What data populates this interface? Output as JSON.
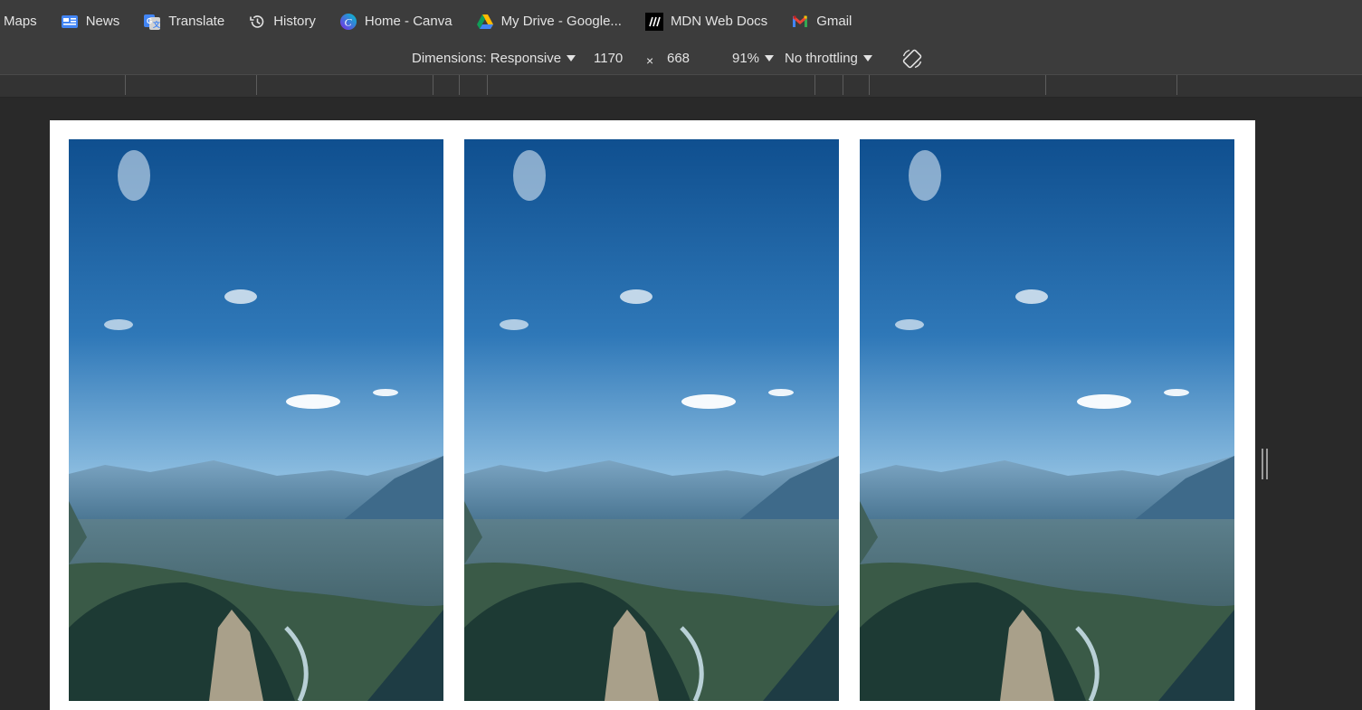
{
  "bookmarks": [
    {
      "label": "Maps",
      "icon": "maps-icon"
    },
    {
      "label": "News",
      "icon": "google-news-icon"
    },
    {
      "label": "Translate",
      "icon": "google-translate-icon"
    },
    {
      "label": "History",
      "icon": "history-icon"
    },
    {
      "label": "Home - Canva",
      "icon": "canva-icon"
    },
    {
      "label": "My Drive - Google...",
      "icon": "google-drive-icon"
    },
    {
      "label": "MDN Web Docs",
      "icon": "mdn-icon"
    },
    {
      "label": "Gmail",
      "icon": "gmail-icon"
    }
  ],
  "device_toolbar": {
    "dimensions_label": "Dimensions: Responsive",
    "width": "1170",
    "times": "×",
    "height": "668",
    "zoom": "91%",
    "throttling": "No throttling",
    "rotate_icon": "rotate-icon"
  },
  "viewport": {
    "images": [
      {
        "name": "mountain-valley-image-1",
        "description": "mountain valley landscape with blue sky"
      },
      {
        "name": "mountain-valley-image-2",
        "description": "mountain valley landscape with blue sky"
      },
      {
        "name": "mountain-valley-image-3",
        "description": "mountain valley landscape with blue sky"
      }
    ]
  },
  "colors": {
    "toolbar_bg": "#3c3c3c",
    "page_bg": "#292929",
    "viewport_bg": "#ffffff",
    "text": "#e3e3e3"
  }
}
